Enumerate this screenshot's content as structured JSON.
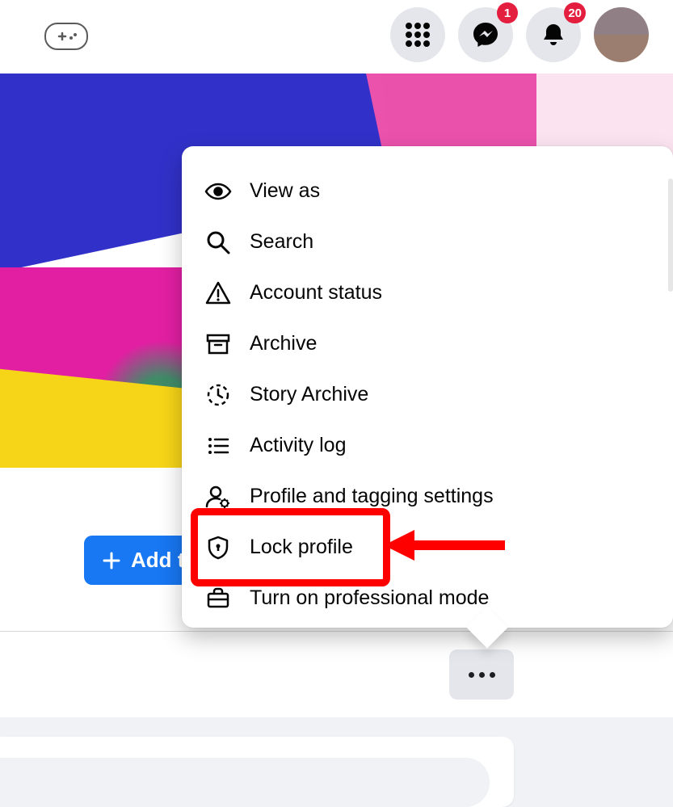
{
  "nav": {
    "messenger_badge": "1",
    "notifications_badge": "20"
  },
  "add_button_label": "Add t",
  "menu": {
    "items": [
      {
        "label": "View as"
      },
      {
        "label": "Search"
      },
      {
        "label": "Account status"
      },
      {
        "label": "Archive"
      },
      {
        "label": "Story Archive"
      },
      {
        "label": "Activity log"
      },
      {
        "label": "Profile and tagging settings"
      },
      {
        "label": "Lock profile"
      },
      {
        "label": "Turn on professional mode"
      }
    ]
  }
}
